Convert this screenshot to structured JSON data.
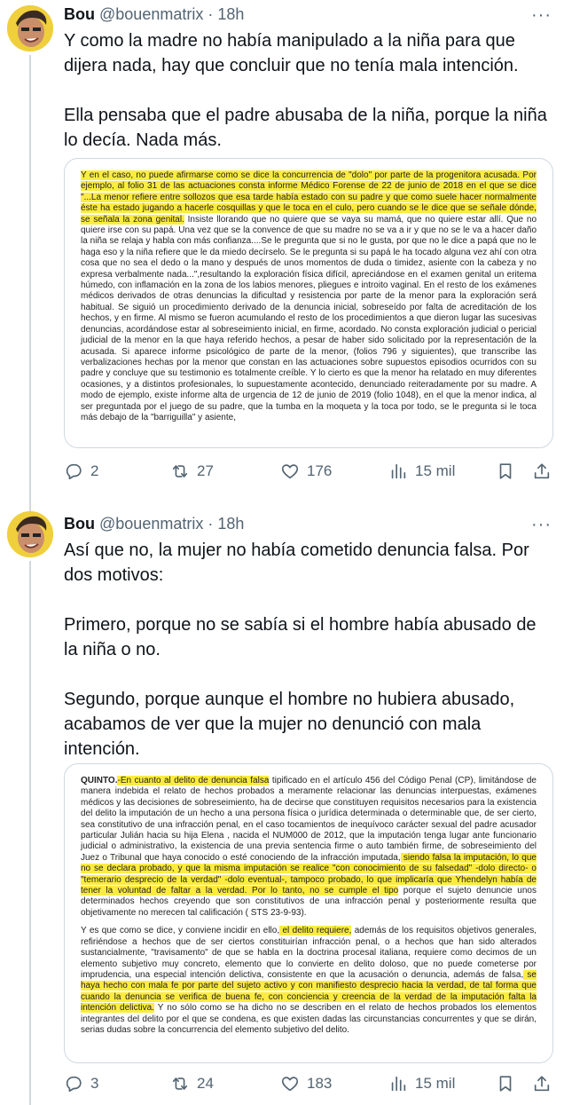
{
  "tweets": [
    {
      "name": "Bou",
      "handle": "@bouenmatrix",
      "dot": "·",
      "time": "18h",
      "more": "···",
      "paragraphs": [
        "Y como la madre no había manipulado a la niña para que dijera nada, hay que concluir que no tenía mala intención.",
        "Ella pensaba que el padre abusaba de la niña, porque la niña lo decía. Nada más."
      ],
      "document_image": {
        "p1_hl": "Y en el caso, no puede afirmarse como se dice la concurrencia de \"dolo\" por parte de la progenitora acusada. Por ejemplo, al folio 31 de las actuaciones consta informe Médico Forense de 22 de junio de 2018 en el que se dice \"...La menor refiere entre sollozos que esa tarde había estado con su padre y que como suele hacer normalmente éste ha estado jugando a hacerle cosquillas y que le toca en el culo, pero cuando se le dice que se señale dónde, se señala la zona genital.",
        "p1_rest": " Insiste llorando que no quiere que se vaya su mamá, que no quiere estar allí. Que no quiere irse con su papá. Una vez que se la convence de que su madre no se va a ir y que no se le va a hacer daño la niña se relaja y habla con más confianza....Se le pregunta que si no le gusta, por que no le dice a papá que no le haga eso y la niña refiere que le da miedo decírselo. Se le pregunta si su papá le ha tocado alguna vez ahí con otra cosa que no sea el dedo o la mano y después de unos momentos de duda o timidez, asiente con la cabeza y no expresa verbalmente nada...\",resultando la exploración física difícil, apreciándose en el examen genital un eritema húmedo, con inflamación en la zona de los labios menores, pliegues e introito vaginal. En el resto de los exámenes médicos derivados de otras denuncias la dificultad y resistencia por parte de la menor para la exploración será habitual. Se siguió un procedimiento derivado de la denuncia inicial, sobreseído por falta de acreditación de los hechos, y en firme. Al mismo se fueron acumulando el resto de los procedimientos a que dieron lugar las sucesivas denuncias, acordándose estar al sobreseimiento inicial, en firme, acordado. No consta exploración judicial o pericial judicial de la menor en la que haya referido hechos, a pesar de haber sido solicitado por la representación de la acusada. Si aparece informe psicológico de parte de la menor, (folios 796 y siguientes), que transcribe las verbalizaciones hechas por la menor que constan en las actuaciones sobre supuestos episodios ocurridos con su padre y concluye que su testimonio es totalmente creíble. Y lo cierto es que la menor ha relatado en muy diferentes ocasiones, y a distintos profesionales, lo supuestamente acontecido, denunciado reiteradamente por su madre. A modo de ejemplo, existe informe alta de urgencia de 12 de junio de 2019 (folio 1048), en el que la menor indica, al ser preguntada por el juego de su padre, que la tumba en la moqueta y la toca por todo, se le pregunta si le toca más debajo de la \"barriguilla\" y asiente,"
      },
      "actions": {
        "replies": "2",
        "retweets": "27",
        "likes": "176",
        "views": "15 mil"
      }
    },
    {
      "name": "Bou",
      "handle": "@bouenmatrix",
      "dot": "·",
      "time": "18h",
      "more": "···",
      "paragraphs": [
        "Así que no, la mujer no había cometido denuncia falsa. Por dos motivos:",
        "Primero, porque no se sabía si el hombre había abusado de la niña o no.",
        "Segundo, porque aunque el hombre no hubiera abusado, acabamos de ver que la mujer no denunció con mala intención."
      ],
      "document_image": {
        "p1_quinto": "QUINTO.",
        "p1_hl1": "-En cuanto al delito de denuncia falsa",
        "p1_a": " tipificado en el artículo 456 del Código Penal (CP), limitándose de manera indebida el relato de hechos probados a meramente relacionar las denuncias interpuestas, exámenes médicos y las decisiones de sobreseimiento, ha de decirse que constituyen requisitos necesarios para la existencia del delito la imputación de un hecho a una persona física o jurídica determinada o determinable que, de ser cierto, sea constitutivo de una infracción penal, en el caso tocamientos de inequívoco carácter sexual del padre acusador particular Julián hacia su hija Elena , nacida el NUM000 de 2012, que la imputación tenga lugar ante funcionario judicial o administrativo, la existencia de una previa sentencia firme o auto también firme, de sobreseimiento del Juez o Tribunal que haya conocido o esté conociendo de la infracción imputada,",
        "p1_hl2": " siendo falsa la imputación, lo que no se declara probado, y que la misma imputación se realice \"con conocimiento de su falsedad\" -dolo directo- o \"temerario desprecio de la verdad\" -dolo eventual-, tampoco probado, lo que implicaría que Yhendelyn había de tener la voluntad de faltar a la verdad. Por lo tanto, no se cumple el tipo",
        "p1_b": " porque el sujeto denuncie unos determinados hechos creyendo que son constitutivos de una infracción penal y posteriormente resulta que objetivamente no merecen tal calificación ( STS 23-9-93).",
        "p2_a": "Y es que como se dice, y conviene incidir en ello,",
        "p2_hl1": " el delito requiere,",
        "p2_b": " además de los requisitos objetivos generales, refiriéndose a hechos que de ser ciertos constituirían infracción penal, o a hechos que han sido alterados sustancialmente, \"travisamento\" de que se habla en la doctrina procesal italiana, requiere como decimos de un elemento subjetivo muy concreto, elemento que lo convierte en delito doloso, que no puede cometerse por imprudencia, una especial intención delictiva, consistente en que la acusación o denuncia, además de falsa,",
        "p2_hl2": " se haya hecho con mala fe por parte del sujeto activo y con manifiesto desprecio hacia la verdad, de tal forma que cuando la denuncia se verifica de buena fe, con conciencia y creencia de la verdad de la imputación falta la intención delictiva.",
        "p2_c": " Y no sólo como se ha dicho no se describen en el relato de hechos probados los elementos integrantes del delito por el que se condena, es que existen dadas las circunstancias concurrentes y que se dirán, serias dudas sobre la concurrencia del elemento subjetivo del delito."
      },
      "actions": {
        "replies": "3",
        "retweets": "24",
        "likes": "183",
        "views": "15 mil"
      }
    }
  ],
  "colors": {
    "text": "#0f1419",
    "secondary": "#536471",
    "border": "#cfd9de",
    "highlight": "#fcec3f"
  },
  "icons": [
    "reply-icon",
    "retweet-icon",
    "like-icon",
    "views-icon",
    "bookmark-icon",
    "share-icon",
    "more-icon"
  ]
}
